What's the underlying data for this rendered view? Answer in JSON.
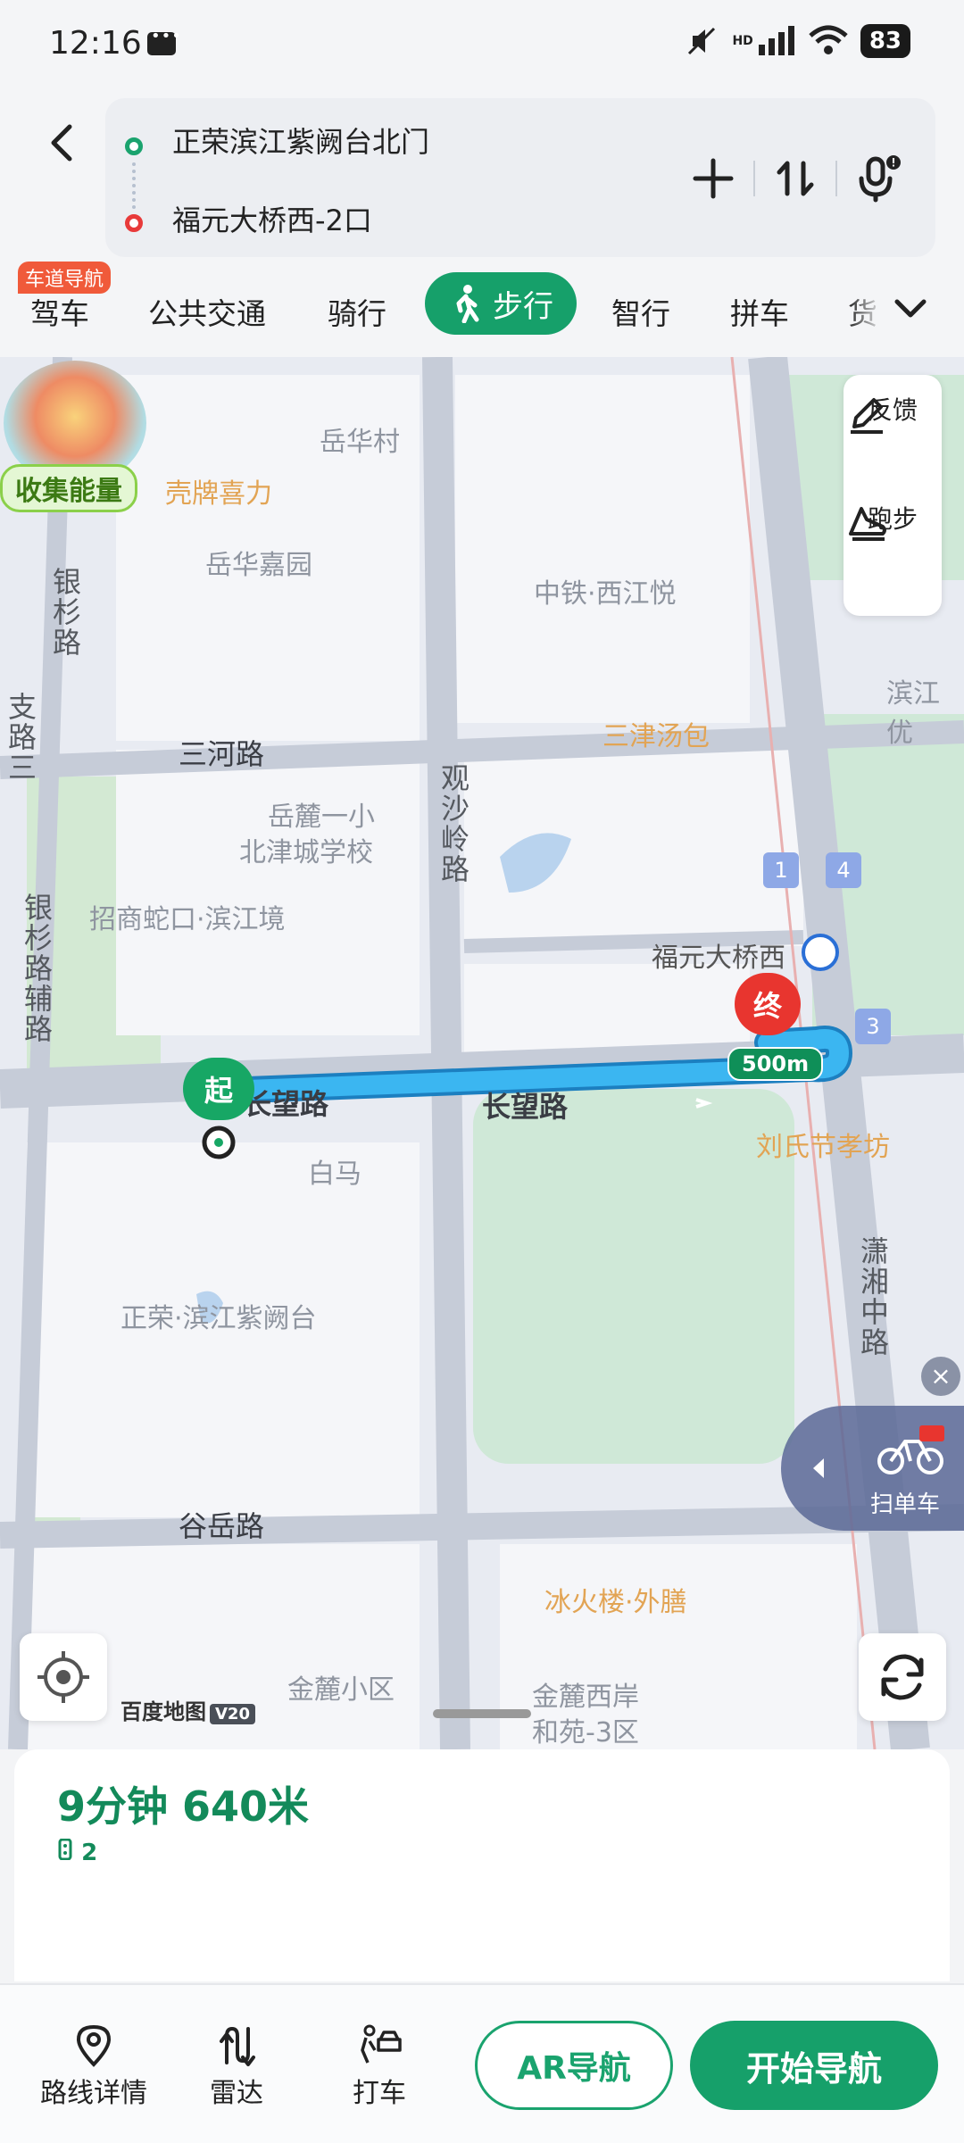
{
  "status_bar": {
    "time": "12:16",
    "battery": "83",
    "network": "HD"
  },
  "route": {
    "start": "正荣滨江紫阙台北门",
    "end": "福元大桥西-2口"
  },
  "tabs": {
    "badge": "车道导航",
    "items": [
      "驾车",
      "公共交通",
      "骑行",
      "步行",
      "智行",
      "拼车",
      "货"
    ],
    "active": "步行"
  },
  "map": {
    "energy_label": "收集能量",
    "side_tools": [
      "反馈",
      "跑步"
    ],
    "labels": [
      "岳华村",
      "岳华嘉园",
      "中铁·西江悦",
      "滨江优",
      "岳麓一小",
      "北津城学校",
      "招商蛇口·滨江境",
      "白马",
      "正荣·滨江紫阙台",
      "金麓小区",
      "金麓西岸",
      "和苑-3区"
    ],
    "pois": [
      "壳牌喜力",
      "三津汤包",
      "刘氏节孝坊",
      "冰火楼·外膳"
    ],
    "streets": [
      "三河路",
      "长望路",
      "长望路",
      "谷岳路"
    ],
    "vertical_streets": [
      "银杉路",
      "支路三",
      "观沙岭路",
      "银杉路辅路",
      "潇湘中路"
    ],
    "station": "福元大桥西",
    "station_exits": [
      "1",
      "4",
      "3"
    ],
    "start_pin": "起",
    "end_pin": "终",
    "distance_tag": "500m",
    "scan_bike": "扫单车",
    "brand": "百度地图",
    "brand_version": "V20"
  },
  "summary": {
    "main": "9分钟 640米",
    "sub": "2"
  },
  "bottom": {
    "items": [
      "路线详情",
      "雷达",
      "打车"
    ],
    "ar_label": "AR导航",
    "nav_label": "开始导航"
  },
  "colors": {
    "accent": "#16a06a",
    "route_line": "#39b2f0",
    "end_pin": "#e8352f"
  }
}
